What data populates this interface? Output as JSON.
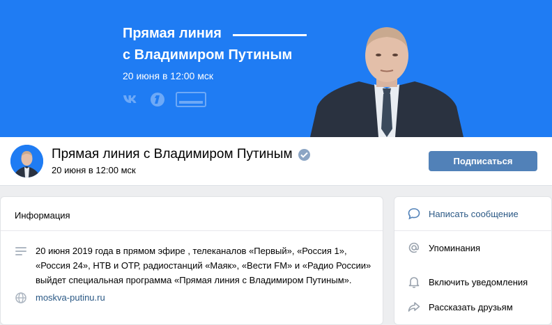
{
  "cover": {
    "title_line1": "Прямая линия",
    "title_line2": "с Владимиром Путиным",
    "date": "20 июня в 12:00 мск",
    "logo_vk": "vk-logo",
    "logo_perviy": "channel-one-logo",
    "logo_russia": "РОССИЯ",
    "bg_color": "#1f7cf3"
  },
  "header": {
    "name": "Прямая линия с Владимиром Путиным",
    "subtitle": "20 июня в 12:00 мск",
    "subscribe_label": "Подписаться",
    "accent": "#5181b8"
  },
  "info": {
    "heading": "Информация",
    "description": "20 июня 2019 года в прямом эфире , телеканалов «Первый», «Россия 1», «Россия 24», НТВ и ОТР, радиостанций «Маяк», «Вести FM» и «Радио России» выйдет специальная программа «Прямая линия с Владимиром Путиным».",
    "website": "moskva-putinu.ru"
  },
  "actions": {
    "message": "Написать сообщение",
    "mentions": "Упоминания",
    "notifications": "Включить уведомления",
    "share": "Рассказать друзьям"
  }
}
